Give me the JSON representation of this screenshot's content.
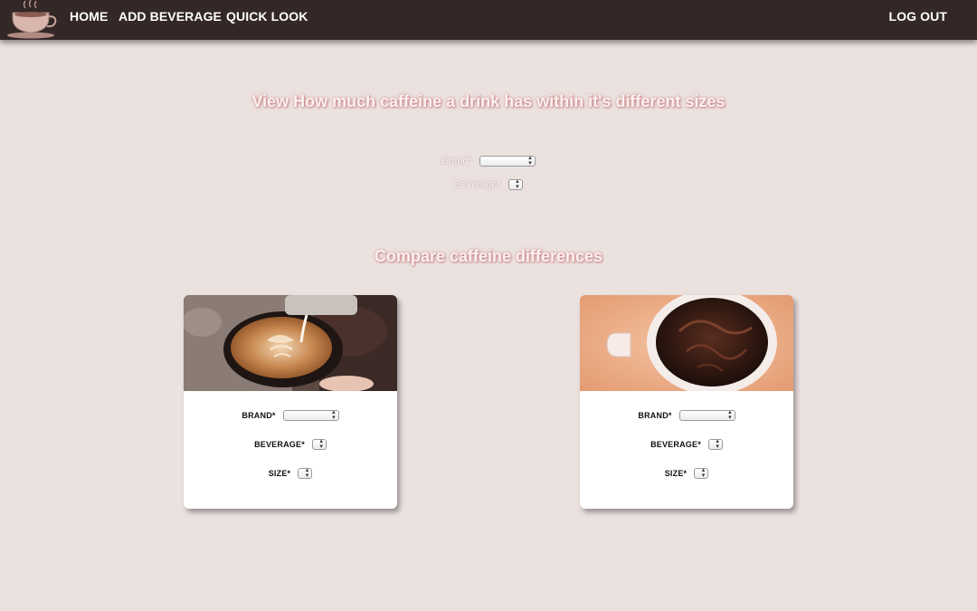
{
  "navbar": {
    "logo_icon": "coffee-cup-logo",
    "links": {
      "home": "HOME",
      "add_beverage": "ADD BEVERAGE",
      "quick_look": "QUICK LOOK",
      "log_out": "LOG OUT"
    }
  },
  "view_section": {
    "heading": "View How much caffeine a drink has within it's different sizes",
    "brand_label": "Brand*",
    "beverage_label": "Beverage*",
    "brand_value": "",
    "beverage_value": ""
  },
  "compare_section": {
    "heading": "Compare caffeine differences",
    "cards": [
      {
        "image_icon": "latte-art-image",
        "brand_label": "BRAND*",
        "beverage_label": "BEVERAGE*",
        "size_label": "SIZE*",
        "brand_value": "",
        "beverage_value": "",
        "size_value": ""
      },
      {
        "image_icon": "black-coffee-image",
        "brand_label": "BRAND*",
        "beverage_label": "BEVERAGE*",
        "size_label": "SIZE*",
        "brand_value": "",
        "beverage_value": "",
        "size_value": ""
      }
    ]
  },
  "colors": {
    "navbar_bg": "#342827",
    "page_bg": "#ebe1df",
    "heading_glow": "#c47c7c",
    "card_bg": "#ffffff"
  }
}
